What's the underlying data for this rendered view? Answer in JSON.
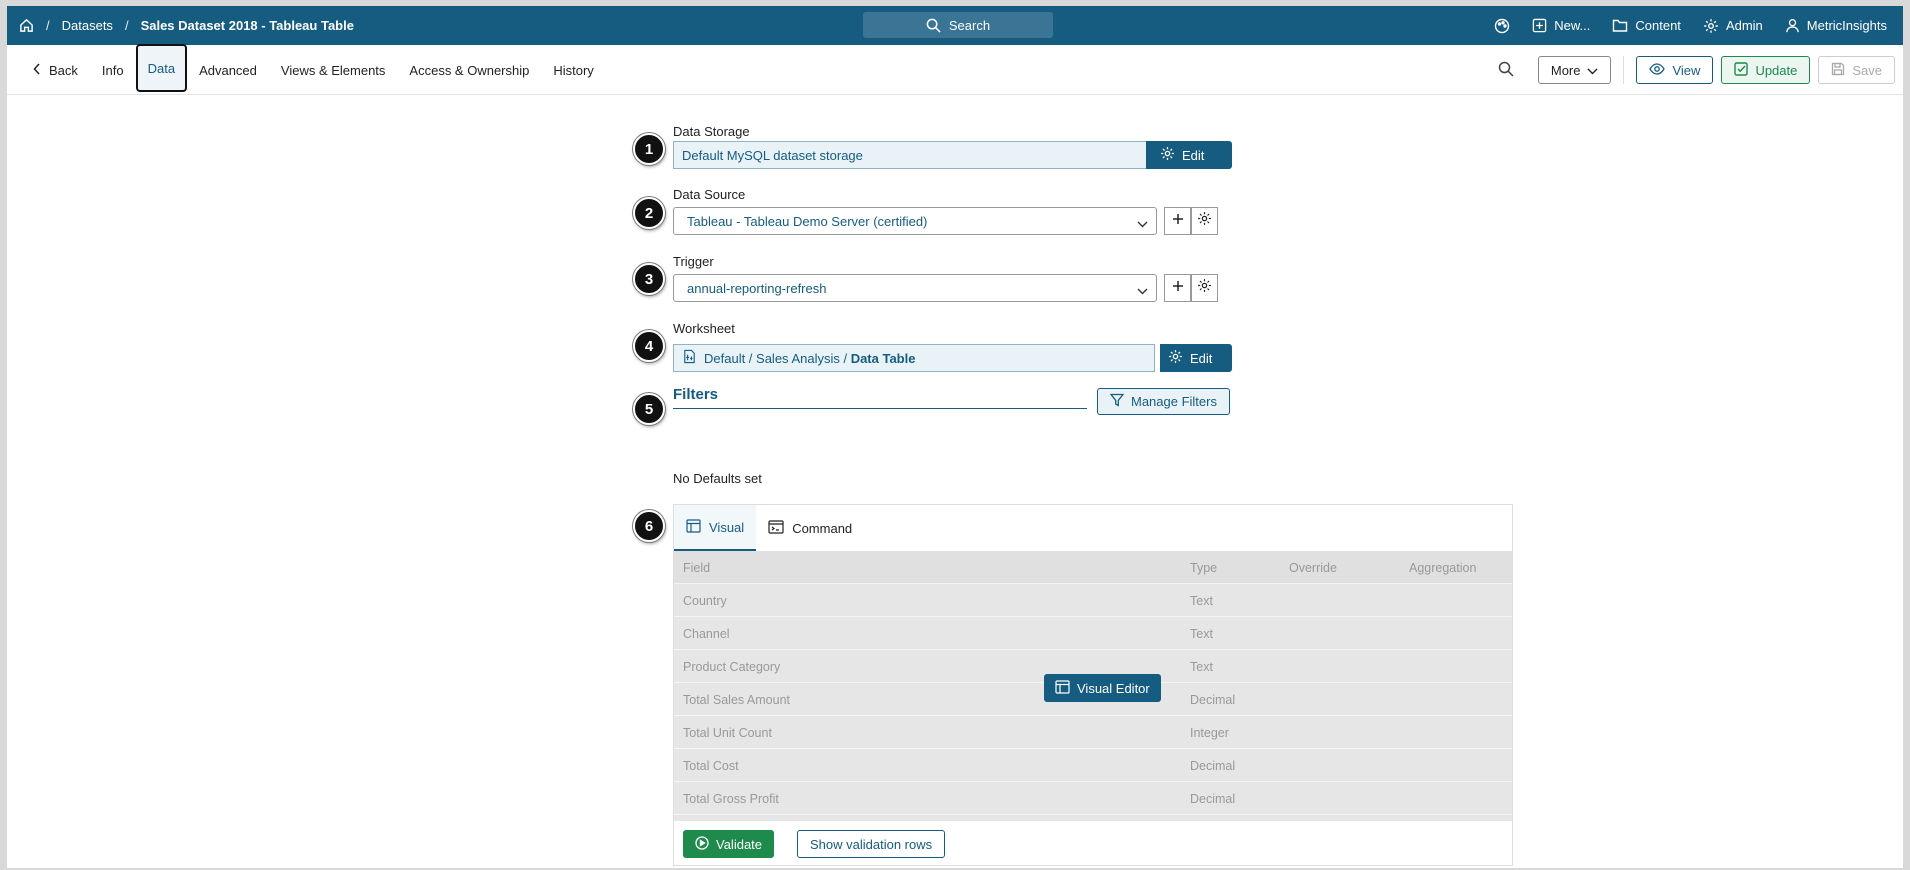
{
  "topbar": {
    "breadcrumb": {
      "home_icon": "home-icon",
      "sep": "/",
      "datasets": "Datasets",
      "current": "Sales Dataset 2018 - Tableau Table"
    },
    "search_label": "Search",
    "new_label": "New...",
    "content_label": "Content",
    "admin_label": "Admin",
    "user_label": "MetricInsights"
  },
  "tabs": {
    "back": "Back",
    "items": [
      "Info",
      "Data",
      "Advanced",
      "Views & Elements",
      "Access & Ownership",
      "History"
    ],
    "active": "Data"
  },
  "toolbar": {
    "more_label": "More",
    "view_label": "View",
    "update_label": "Update",
    "save_label": "Save"
  },
  "form": {
    "storage": {
      "label": "Data Storage",
      "value": "Default MySQL dataset storage",
      "edit": "Edit",
      "step": "1"
    },
    "source": {
      "label": "Data Source",
      "value": "Tableau - Tableau Demo Server (certified)",
      "step": "2"
    },
    "trigger": {
      "label": "Trigger",
      "value": "annual-reporting-refresh",
      "step": "3"
    },
    "worksheet": {
      "label": "Worksheet",
      "path": "Default / Sales Analysis / ",
      "name": "Data Table",
      "edit": "Edit",
      "step": "4"
    },
    "filters": {
      "title": "Filters",
      "manage": "Manage Filters",
      "step": "5"
    },
    "no_defaults": "No Defaults set"
  },
  "editor": {
    "step": "6",
    "tab_visual": "Visual",
    "tab_command": "Command",
    "columns": {
      "field": "Field",
      "type": "Type",
      "override": "Override",
      "aggregation": "Aggregation"
    },
    "rows": [
      {
        "field": "Country",
        "type": "Text"
      },
      {
        "field": "Channel",
        "type": "Text"
      },
      {
        "field": "Product Category",
        "type": "Text"
      },
      {
        "field": "Total Sales Amount",
        "type": "Decimal"
      },
      {
        "field": "Total Unit Count",
        "type": "Integer"
      },
      {
        "field": "Total Cost",
        "type": "Decimal"
      },
      {
        "field": "Total Gross Profit",
        "type": "Decimal"
      }
    ],
    "visual_editor": "Visual Editor",
    "validate": "Validate",
    "show_validation_rows": "Show validation rows"
  },
  "colors": {
    "brand": "#155c80",
    "success": "#1e8a4c"
  }
}
